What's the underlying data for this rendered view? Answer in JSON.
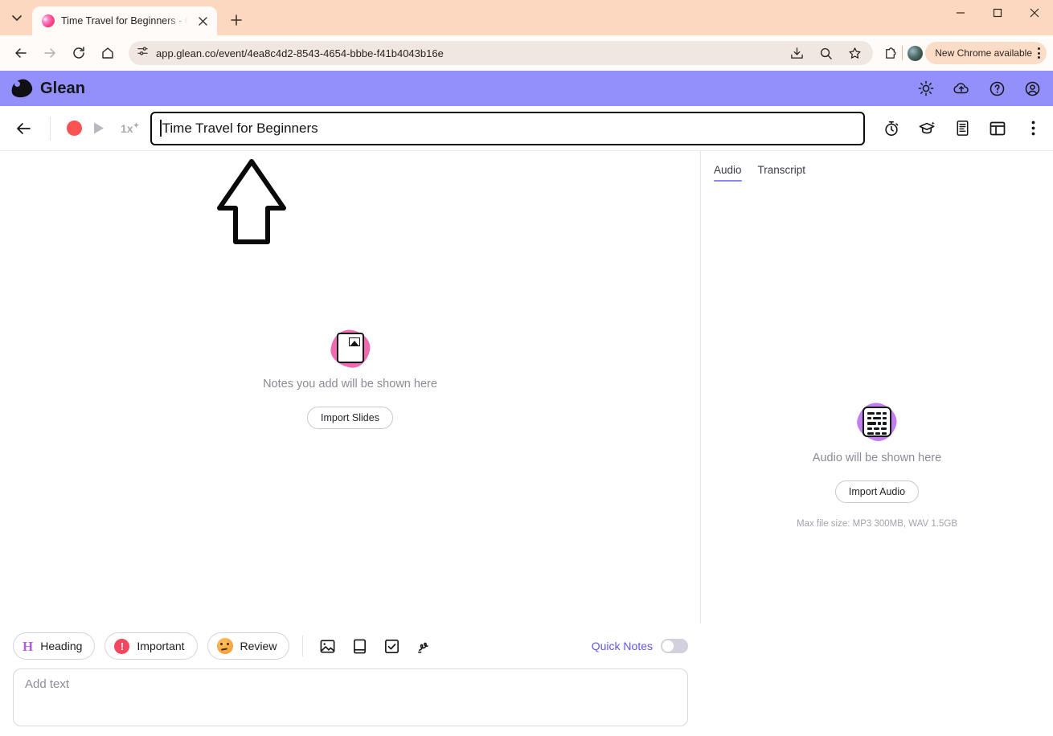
{
  "browser": {
    "tab": {
      "title": "Time Travel for Beginners - Glea",
      "favicon": "glean-favicon"
    },
    "newtab_label": "+",
    "window_controls": {
      "minimize": "–",
      "maximize": "□",
      "close": "✕"
    },
    "url": "app.glean.co/event/4ea8c4d2-8543-4654-bbbe-f41b4043b16e",
    "chrome_update": {
      "label": "New Chrome available"
    },
    "icons": [
      "back-arrow",
      "forward-arrow",
      "reload",
      "home",
      "site-settings",
      "install-app",
      "zoom",
      "bookmark-star",
      "extensions",
      "profile-avatar",
      "chrome-menu"
    ]
  },
  "app": {
    "brand": "Glean",
    "header_icons": [
      "brightness-icon",
      "cloud-upload-icon",
      "help-icon",
      "account-icon"
    ],
    "event_bar": {
      "back": "back-arrow",
      "record": "record-dot",
      "play": "play-icon",
      "speed": "1x",
      "title_value": "Time Travel for Beginners",
      "icons": [
        "stopwatch-icon",
        "study-icon",
        "transcript-icon",
        "layout-icon",
        "more-icon"
      ]
    },
    "notes": {
      "empty_text": "Notes you add will be shown here",
      "import_button": "Import Slides",
      "icon": "slides-document-icon"
    },
    "audio_panel": {
      "tabs": [
        {
          "label": "Audio",
          "active": true
        },
        {
          "label": "Transcript",
          "active": false
        }
      ],
      "empty_text": "Audio will be shown here",
      "import_button": "Import Audio",
      "hint": "Max file size: MP3 300MB, WAV 1.5GB",
      "icon": "audio-document-icon"
    },
    "bottom_bar": {
      "chips": [
        {
          "label": "Heading",
          "icon": "heading-h-icon"
        },
        {
          "label": "Important",
          "icon": "important-exclamation-icon"
        },
        {
          "label": "Review",
          "icon": "review-face-icon"
        }
      ],
      "tools": [
        "image-icon",
        "book-icon",
        "checkbox-icon",
        "scribble-icon"
      ],
      "quick_notes_label": "Quick Notes",
      "quick_notes_on": false,
      "add_text_placeholder": "Add text"
    }
  },
  "annotation": {
    "shape": "up-arrow-pointing-to-title-field"
  },
  "colors": {
    "brand_purple": "#9390fb",
    "accent_indigo": "#5d57e8",
    "record_red": "#fa5252",
    "browser_chrome": "#fbd8bf"
  }
}
